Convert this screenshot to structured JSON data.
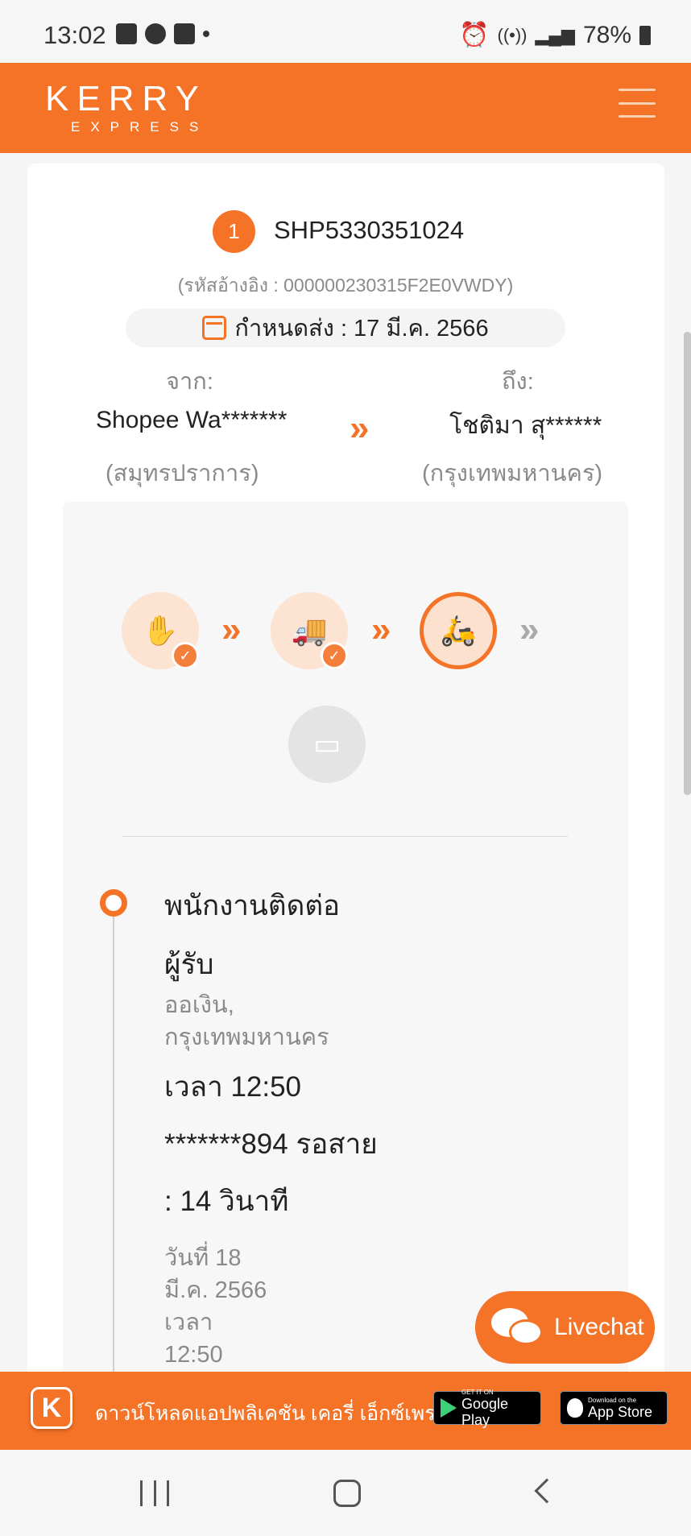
{
  "statusbar": {
    "time": "13:02",
    "battery": "78%"
  },
  "header": {
    "logo_main": "KERRY",
    "logo_sub": "EXPRESS"
  },
  "shipment": {
    "index": "1",
    "tracking_no": "SHP5330351024",
    "ref_code": "(รหัสอ้างอิง : 000000230315F2E0VWDY)",
    "due_date": "กำหนดส่ง : 17 มี.ค. 2566",
    "from_label": "จาก:",
    "from_name": "Shopee Wa*******",
    "from_city": "(สมุทรปราการ)",
    "to_label": "ถึง:",
    "to_name": "โชติมา สุ******",
    "to_city": "(กรุงเทพมหานคร)"
  },
  "progress": {
    "steps": [
      {
        "name": "picked-up",
        "icon": "package-hand-icon",
        "state": "done"
      },
      {
        "name": "in-transit",
        "icon": "truck-icon",
        "state": "done"
      },
      {
        "name": "out-for-delivery",
        "icon": "scooter-rider-icon",
        "state": "current"
      },
      {
        "name": "delivered",
        "icon": "box-icon",
        "state": "pending"
      }
    ]
  },
  "event": {
    "title": "พนักงานติดต่อ",
    "who": "ผู้รับ",
    "location_line1": "ออเงิน,",
    "location_line2": "กรุงเทพมหานคร",
    "time": "เวลา 12:50",
    "call": "*******894 รอสาย",
    "duration": ": 14 วินาที",
    "date_line1": "วันที่ 18",
    "date_line2": "มี.ค. 2566",
    "date_line3": "เวลา",
    "date_line4": "12:50"
  },
  "livechat_label": "Livechat",
  "banner": {
    "text": "ดาวน์โหลดแอปพลิเคชัน เคอรี่ เอ็กซ์เพรส",
    "google_small": "GET IT ON",
    "google_big": "Google Play",
    "apple_small": "Download on the",
    "apple_big": "App Store"
  },
  "colors": {
    "brand": "#f47327",
    "pending": "#aaaaaa"
  }
}
